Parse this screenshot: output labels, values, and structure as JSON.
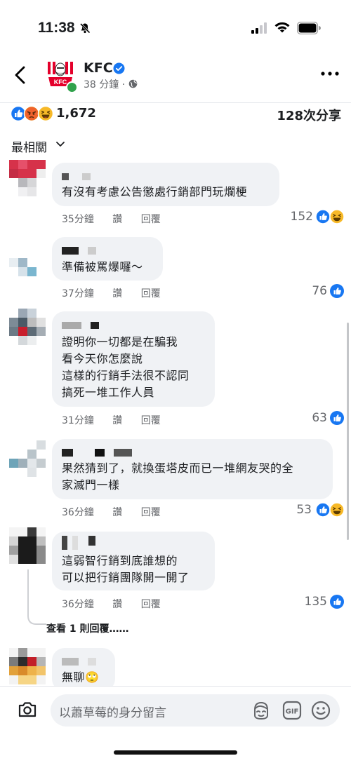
{
  "status": {
    "time": "11:38"
  },
  "header": {
    "page_name": "KFC",
    "post_age": "38 分鐘 ·"
  },
  "reactions": {
    "count": "1,672",
    "shares": "128次分享"
  },
  "sort_label": "最相關",
  "comments": [
    {
      "text": "有沒有考慮公告懲處行銷部門玩爛梗",
      "time": "35分鐘",
      "like": "讚",
      "reply": "回覆",
      "reaction_count": "152",
      "reactions": [
        "like",
        "haha"
      ]
    },
    {
      "text": "準備被罵爆囉～",
      "time": "37分鐘",
      "like": "讚",
      "reply": "回覆",
      "reaction_count": "76",
      "reactions": [
        "like"
      ]
    },
    {
      "text": "證明你一切都是在騙我\n看今天你怎麼說\n這樣的行銷手法很不認同\n搞死一堆工作人員",
      "time": "31分鐘",
      "like": "讚",
      "reply": "回覆",
      "reaction_count": "63",
      "reactions": [
        "like"
      ]
    },
    {
      "text": "果然猜到了，就換蛋塔皮而已一堆網友哭的全\n家滅門一樣",
      "time": "36分鐘",
      "like": "讚",
      "reply": "回覆",
      "reaction_count": "53",
      "reactions": [
        "like",
        "haha"
      ]
    },
    {
      "text": "這弱智行銷到底誰想的\n可以把行銷團隊開一開了",
      "time": "36分鐘",
      "like": "讚",
      "reply": "回覆",
      "reaction_count": "135",
      "reactions": [
        "like"
      ]
    },
    {
      "text": "無聊🙄"
    }
  ],
  "view_replies": "查看 1 則回覆……",
  "composer": {
    "placeholder": "以蕭草莓的身分留言"
  },
  "colors": {
    "like_blue": "#1877f2",
    "haha_yellow": "#f7b928",
    "angry_orange": "#e9710f",
    "online_green": "#31a24c"
  }
}
